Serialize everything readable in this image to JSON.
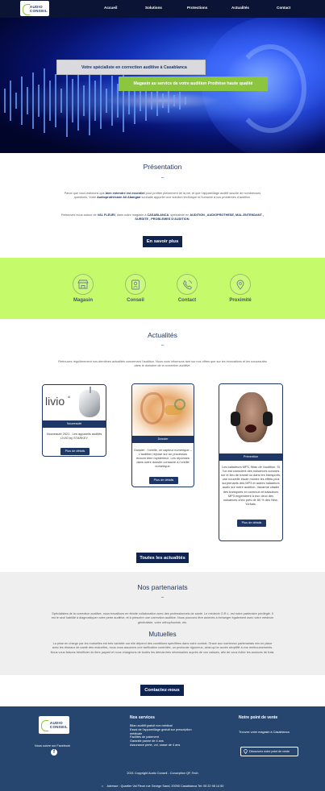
{
  "nav": {
    "logo": {
      "line1": "AUDIO",
      "line2": "CONSEIL"
    },
    "items": [
      "Accueil",
      "Solutions",
      "Protections",
      "Actualités",
      "Contact"
    ]
  },
  "hero": {
    "tagline": "Votre spécialiste en correction auditive à Casablanca",
    "subline": "Magasin au service de votre audition Prothèse haute qualité"
  },
  "presentation": {
    "title": "Présentation",
    "dash": "–",
    "p1_a": "Parce que vous estimons que",
    "p1_b": "bien entendre est essentiel",
    "p1_c": "pour profiter pleinement de la vie, et que l’appareillage auditif suscite de nombreuses questions, Votre",
    "p1_d": "Audioprothésiste Ali Abangair",
    "p1_e": "souhaite apporter une solution technique et humaine à vos problèmes d’audition.",
    "p2_a": "Retrouvez nous autour de",
    "p2_b": "VAL FLEURI",
    "p2_c": ", dans notre magasin à",
    "p2_d": "CASABLANCA",
    "p2_e": ", spécialiste en",
    "p2_f": "AUDITION , AUDIOPROTHESE, MAL-ENTENDANT , SURDITE , PROBLEMES D’AUDITION",
    "p2_g": ".",
    "button": "En savoir plus"
  },
  "features": [
    {
      "label": "Magasin",
      "icon": "shop-icon"
    },
    {
      "label": "Conseil",
      "icon": "contact-card-icon"
    },
    {
      "label": "Contact",
      "icon": "phone-icon"
    },
    {
      "label": "Proximité",
      "icon": "map-pin-icon"
    }
  ],
  "news": {
    "title": "Actualités",
    "dash": "–",
    "intro": "Retrouvez régulièrement nos dernières actualités concernant l’audition. Nous vous informons tant sur nos offres que sur les innovations et les nouveautés dans le domaine de la correction auditive.",
    "cards": [
      {
        "tag": "Nouveauté",
        "text": "Nouveauté 2021 : Les appareils auditifs LIVIO by STARKEY",
        "button": "Plus de détails",
        "brand": "livio",
        "brand_ai": "AI"
      },
      {
        "tag": "Dossier",
        "text": "Dossier : l’oreille, ce capteur numérique – L’audition repose sur un processus encore bien mystérieux. Les réponses dans notre dossier consacré à l’oreille numérique.",
        "button": "Plus de détails"
      },
      {
        "tag": "Prévention",
        "text": "Les baladeurs MP3, fléau de l’audition. Si l’on est conscient des nuisances sonores sur le lieu de travail ou dans les transports, une nouvelle étude montre les effets plus surprenants des MP3 et autres baladeurs audio sur notre audition. Vacarme citadin des transports en commun et baladeurs MP3 engendrent à eux deux des nuisances chez près de 80 % des New-Yorkais.",
        "button": "Plus de détails"
      }
    ],
    "all_button": "Toutes les actualités"
  },
  "partners": {
    "title": "Nos partenariats",
    "dash": "–",
    "text": "Spécialistes de la correction auditive, nous travaillons en étroite collaboration avec des professionnels de santé. Le médecin O.R.L. est notre partenaire privilégié. Il est le seul habilité à diagnostiquer votre perte auditive, et à prescrire une correction auditive. Nous pouvons être amenés à échanger également avec votre médecin généraliste, votre orthophoniste, etc.",
    "subtitle": "Mutuelles",
    "text2": "La prise en charge par les mutuelles est très variable car elle dépend des conditions spécifiées dans votre contrat. Grace aux nombreux partenariats mis en place avec les réseaux de santé des mutuelles, nous vous assurons une tarification contrôlée, un protocole rigoureux, ainsi qu’un accès simplifié à vos remboursements. Nous vous faisons bénéficier du tiers payant et nous chargeons de toutes les démarches nécessaires auprès de vos caisses, afin de vous éviter les avances de frais.",
    "button": "Contactez-nous"
  },
  "footer": {
    "follow": "Nous suivre sur Facebook",
    "services_title": "Nos services",
    "services": [
      "Bilan auditif gratuit non médical",
      "Essai de l’appareillage gratuit sur prescription médicale",
      "Facilités de paiement",
      "Garantie panne de 4 ans",
      "Assurance perte, vol, casse de 4 ans"
    ],
    "point_title": "Notre point de vente",
    "point_text": "Trouvez votre magasin à Casablanca",
    "point_button": "Découvrez notre point de vente",
    "copyright": "2021 Copyright Audio Conseil - Conception QF-Tech",
    "address": "Adresse : Quartier Val Fleuri rue George Sand, 20090 Casablanca Tel: 05 22 98 14 50"
  }
}
